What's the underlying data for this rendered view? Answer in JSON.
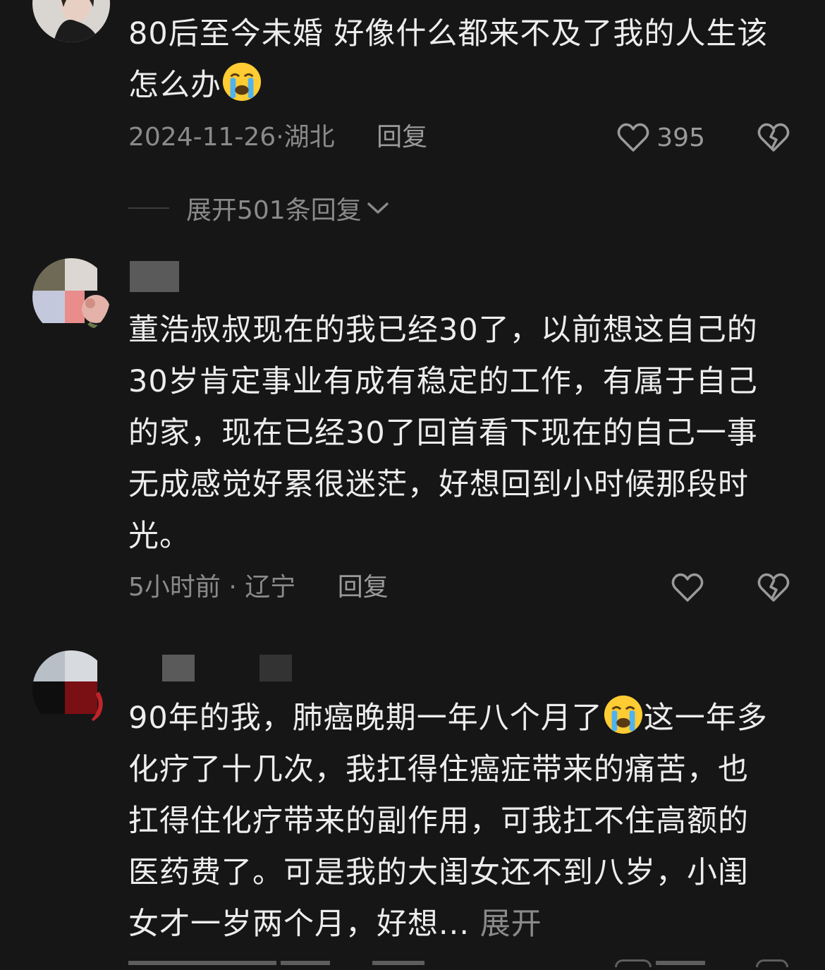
{
  "comments": [
    {
      "text_lines": [
        "80后至今未婚 好像什么都来不及了我的人生该",
        "怎么办"
      ],
      "emoji": "crying-face",
      "date": "2024-11-26",
      "location": "湖北",
      "reply_label": "回复",
      "likes": "395"
    },
    {
      "text_lines": [
        "董浩叔叔现在的我已经30了，以前想这自己的",
        "30岁肯定事业有成有稳定的工作，有属于自己",
        "的家，现在已经30了回首看下现在的自己一事",
        "无成感觉好累很迷茫，好想回到小时候那段时",
        "光。"
      ],
      "date": "5小时前",
      "location": "辽宁",
      "reply_label": "回复"
    },
    {
      "text_lines": [
        "90年的我，肺癌晚期一年八个月了",
        "化疗了十几次，我扛得住癌症带来的痛苦，也",
        "扛得住化疗带来的副作用，可我扛不住高额的",
        "医药费了。可是我的大闺女还不到八岁，小闺",
        "女才一岁两个月，好想..."
      ],
      "line1_after_emoji": "这一年多",
      "expand_label": "展开"
    }
  ],
  "expand_replies": {
    "label": "展开501条回复"
  },
  "colors": {
    "background": "#161616",
    "text": "#ededed",
    "meta": "#8a8a8a"
  }
}
